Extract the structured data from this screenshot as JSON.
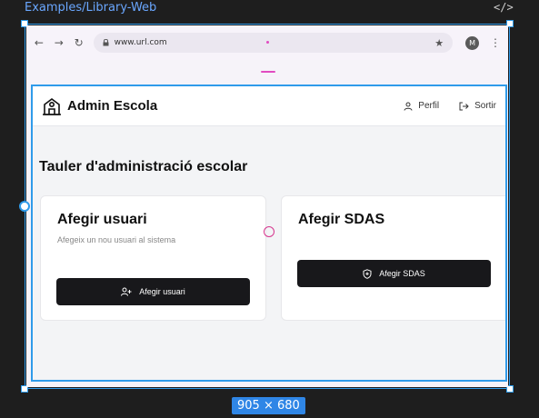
{
  "editor": {
    "frame_label": "Examples/Library-Web",
    "code_icon": "</>",
    "dimensions": "905 × 680"
  },
  "browser": {
    "url": "www.url.com",
    "back_icon": "←",
    "forward_icon": "→",
    "reload_icon": "↻",
    "lock_icon": "lock",
    "star_icon": "★",
    "avatar_initial": "M",
    "menu_icon": "⋮"
  },
  "app": {
    "brand": "Admin Escola",
    "profile_label": "Perfil",
    "logout_label": "Sortir",
    "page_title": "Tauler d'administració escolar",
    "cards": [
      {
        "title": "Afegir usuari",
        "description": "Afegeix un nou usuari al sistema",
        "button_label": "Afegir usuari"
      },
      {
        "title": "Afegir SDAS",
        "button_label": "Afegir SDAS"
      }
    ]
  },
  "colors": {
    "accent": "#2f9bea",
    "primary_button": "#18181b",
    "magenta_marker": "#e14bc1"
  }
}
